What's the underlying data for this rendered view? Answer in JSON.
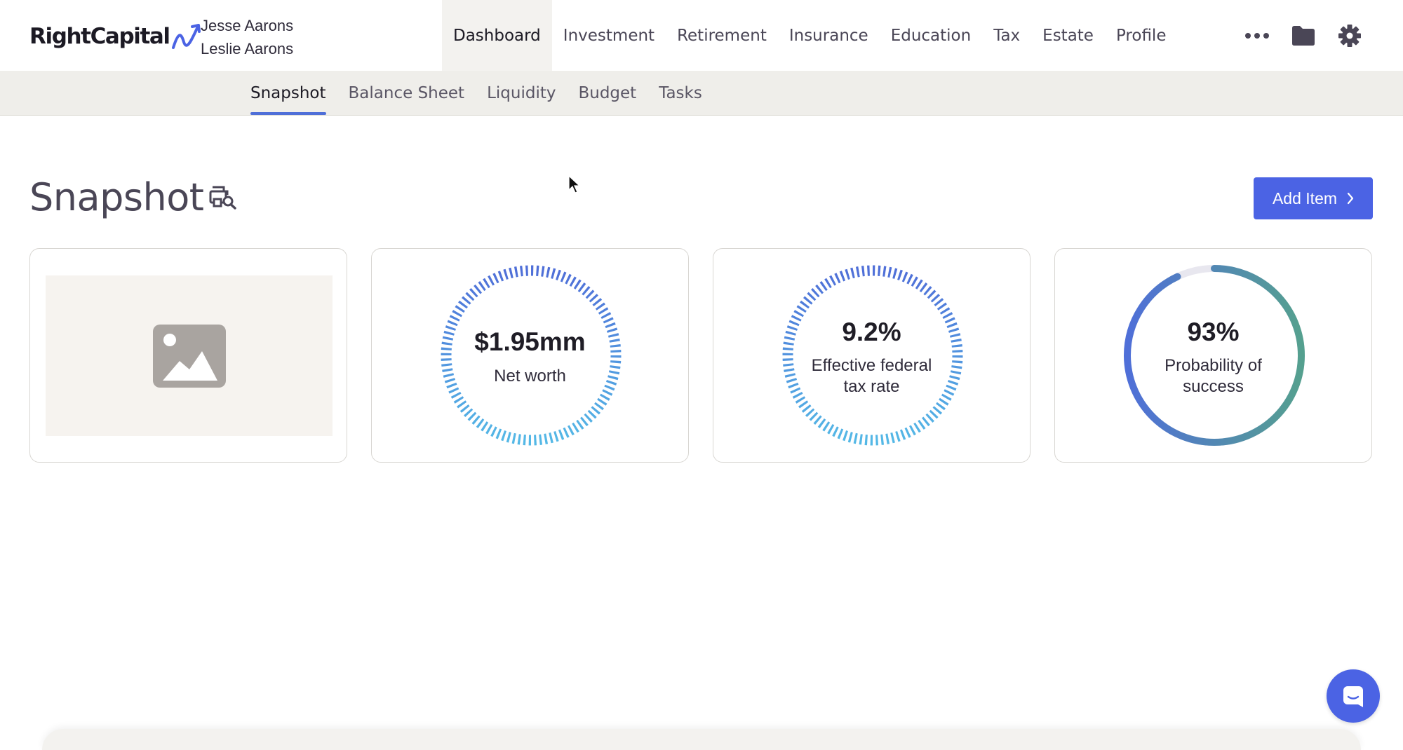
{
  "brand": {
    "name": "RightCapital",
    "accent": "#4b63e4"
  },
  "clients": [
    "Jesse Aarons",
    "Leslie Aarons"
  ],
  "nav": {
    "items": [
      "Dashboard",
      "Investment",
      "Retirement",
      "Insurance",
      "Education",
      "Tax",
      "Estate",
      "Profile"
    ],
    "active": "Dashboard",
    "icons": [
      "more-icon",
      "folder-icon",
      "gear-icon"
    ]
  },
  "subnav": {
    "items": [
      "Snapshot",
      "Balance Sheet",
      "Liquidity",
      "Budget",
      "Tasks"
    ],
    "active": "Snapshot"
  },
  "page": {
    "title": "Snapshot",
    "add_button": "Add Item"
  },
  "cards": [
    {
      "type": "image-placeholder",
      "icon": "image-icon"
    },
    {
      "value": "$1.95mm",
      "label_lines": [
        "Net worth"
      ],
      "style": "dashed-ring"
    },
    {
      "value": "9.2%",
      "label_lines": [
        "Effective federal",
        "tax rate"
      ],
      "style": "dashed-ring"
    },
    {
      "value": "93%",
      "label_lines": [
        "Probability of",
        "success"
      ],
      "style": "progress-ring",
      "progress": 0.93
    }
  ],
  "colors": {
    "ring_top": "#4f6fd8",
    "ring_bottom": "#54b8e6",
    "progress_start": "#4f6fd8",
    "progress_end": "#55a08f",
    "track": "#e8e7ef"
  }
}
